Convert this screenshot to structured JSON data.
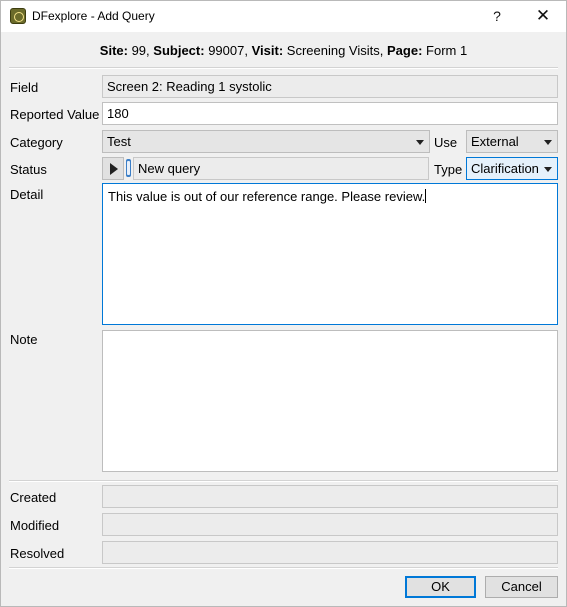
{
  "window": {
    "title": "DFexplore - Add Query",
    "help_label": "?",
    "close_label": "✕"
  },
  "context": {
    "site_label": "Site:",
    "site_value": "99,",
    "subject_label": "Subject:",
    "subject_value": "99007,",
    "visit_label": "Visit:",
    "visit_value": "Screening Visits,",
    "page_label": "Page:",
    "page_value": "Form 1"
  },
  "form": {
    "field_label": "Field",
    "field_value": "Screen 2: Reading 1 systolic",
    "reported_label": "Reported Value",
    "reported_value": "180",
    "category_label": "Category",
    "category_value": "Test",
    "use_label": "Use",
    "use_value": "External",
    "status_label": "Status",
    "status_value": "New query",
    "type_label": "Type",
    "type_value": "Clarification",
    "detail_label": "Detail",
    "detail_value": "This value is out of our reference range. Please review.",
    "note_label": "Note",
    "note_value": "",
    "created_label": "Created",
    "created_value": "",
    "modified_label": "Modified",
    "modified_value": "",
    "resolved_label": "Resolved",
    "resolved_value": ""
  },
  "buttons": {
    "ok": "OK",
    "cancel": "Cancel"
  },
  "icons": {
    "app": "dfexplore-app-icon",
    "status_play": "play-icon",
    "dropdown": "chevron-down-icon"
  },
  "colors": {
    "focus_border": "#0078d7",
    "status_chip": "#3c7fc7"
  }
}
